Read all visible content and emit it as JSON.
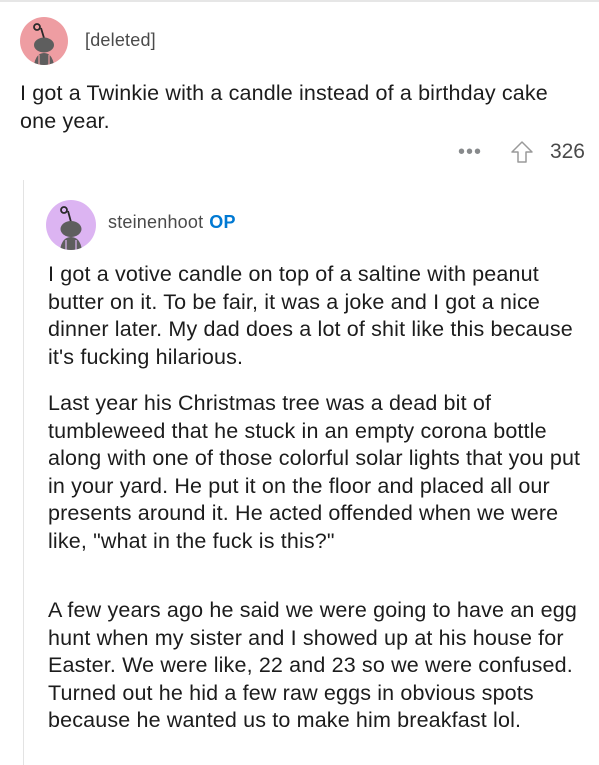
{
  "comment1": {
    "author": "[deleted]",
    "body": "I got a Twinkie with a candle instead of a birthday cake one year.",
    "more_label": "•••",
    "score": "326"
  },
  "comment2": {
    "author": "steinenhoot",
    "op_badge": "OP",
    "paragraphs": [
      "I got a votive candle on top of a saltine with peanut butter on it. To be fair, it was a joke and I got a nice dinner later. My dad does a lot of shit like this because it's fucking hilarious.",
      "Last year his Christmas tree was a dead bit of tumbleweed that he stuck in an empty corona bottle along with one of those colorful solar lights that you put in your yard. He put it on the floor and placed all our presents around it. He acted offended when we were like, \"what in the fuck is this?\"",
      "A few years ago he said we were going to have an egg hunt when my sister and I showed up at his house for Easter. We were like, 22 and 23 so we were confused. Turned out he hid a few raw eggs in obvious spots because he wanted us to make him breakfast lol."
    ]
  },
  "colors": {
    "avatar1_bg": "#ee9da2",
    "avatar2_bg": "#dcb4f2",
    "op_badge": "#0079d3",
    "meta_gray": "#878a8c"
  },
  "icons": [
    "snoo-avatar-icon",
    "upvote-arrow-icon",
    "more-options-icon"
  ]
}
